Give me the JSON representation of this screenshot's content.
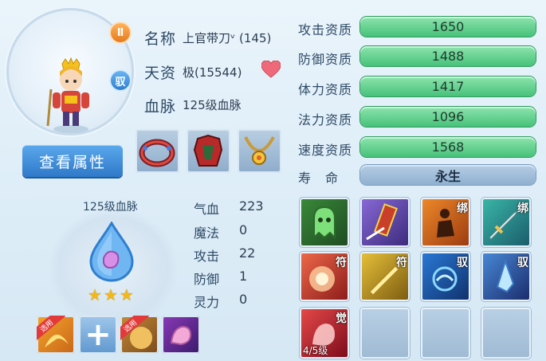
{
  "pet": {
    "name_label": "名称",
    "name_value": "上官带刀ᵛ (145)",
    "talent_label": "天资",
    "talent_value": "极(15544)",
    "bloodline_label": "血脉",
    "bloodline_value": "125级血脉",
    "badge_top": "Ⅱ",
    "badge_mid": "驭"
  },
  "buttons": {
    "view_attributes": "查看属性"
  },
  "bloodline_panel": {
    "title": "125级血脉",
    "stars": 3,
    "stats": [
      {
        "label": "气血",
        "value": "223"
      },
      {
        "label": "魔法",
        "value": "0"
      },
      {
        "label": "攻击",
        "value": "22"
      },
      {
        "label": "防御",
        "value": "1"
      },
      {
        "label": "灵力",
        "value": "0"
      }
    ]
  },
  "qualities": [
    {
      "label": "攻击资质",
      "value": "1650"
    },
    {
      "label": "防御资质",
      "value": "1488"
    },
    {
      "label": "体力资质",
      "value": "1417"
    },
    {
      "label": "法力资质",
      "value": "1096"
    },
    {
      "label": "速度资质",
      "value": "1568"
    }
  ],
  "lifespan": {
    "label": "寿　命",
    "value": "永生"
  },
  "skill_tags": {
    "bind": "绑",
    "charm": "符",
    "ride": "驭",
    "awaken": "觉",
    "awaken_level": "4/5级",
    "select": "选用"
  },
  "colors": {
    "accent": "#2f79c9",
    "bar_green": "#46c27a",
    "bar_blue": "#8fb0d0"
  }
}
